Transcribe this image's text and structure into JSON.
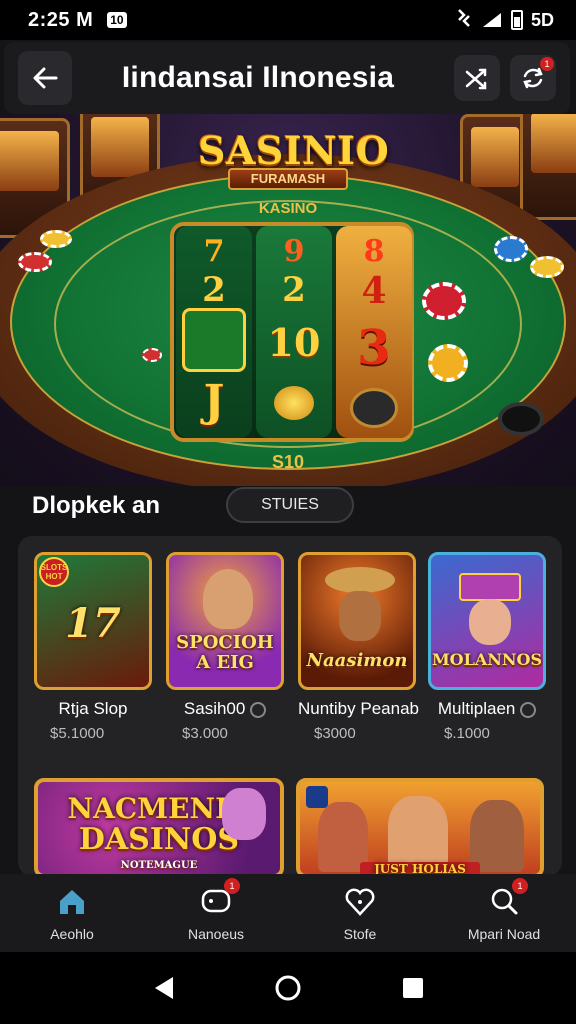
{
  "status_bar": {
    "time": "2:25 M",
    "badge": "10",
    "battery_text": "5D"
  },
  "header": {
    "title": "Iindansai Ilnonesia",
    "back_icon": "arrow-left-icon",
    "action1_icon": "shuffle-icon",
    "action2_icon": "refresh-icon",
    "notif_count": "1"
  },
  "hero": {
    "logo": "SASINIO",
    "logo_sub": "FURAMASH",
    "table_label": "KASINO",
    "bet_label": "S10",
    "reels": [
      [
        "7",
        "2",
        "J"
      ],
      [
        "9",
        "2",
        "10"
      ],
      [
        "8",
        "4",
        "3"
      ]
    ]
  },
  "section": {
    "title": "Dlopkek an",
    "pill": "STUIES"
  },
  "games": [
    {
      "name": "Rtja Slop",
      "price": "$5.1000",
      "art": "17",
      "corner": "SLOTS HOT",
      "colors": [
        "#1e7a3a",
        "#8a2a12"
      ]
    },
    {
      "name": "Sasih00",
      "price": "$3.000",
      "art": "SPOCIOH A EIG",
      "corner": "",
      "colors": [
        "#8a2ab0",
        "#f07a1a"
      ]
    },
    {
      "name": "Nuntiby Peanab",
      "price": "$3000",
      "art": "Naasimon",
      "corner": "",
      "colors": [
        "#d0501a",
        "#4a1a08"
      ]
    },
    {
      "name": "Multiplaen",
      "price": "$.1000",
      "art": "MOLANNOS",
      "corner": "",
      "colors": [
        "#3a6ad0",
        "#b02aa0"
      ]
    }
  ],
  "banners": [
    {
      "line1": "NACMENIC",
      "line2": "DASINOS",
      "line3": "NOTEMAGUE"
    },
    {
      "caption": "JUST HOLIAS"
    }
  ],
  "bottom_nav": [
    {
      "label": "Aeohlo",
      "icon": "home-icon"
    },
    {
      "label": "Nanoeus",
      "icon": "chat-icon",
      "dot": "1"
    },
    {
      "label": "Stofe",
      "icon": "heart-icon"
    },
    {
      "label": "Mpari Noad",
      "icon": "profile-search-icon",
      "dot": "1"
    }
  ],
  "colors": {
    "accent_gold": "#e0a030",
    "felt_green": "#117334",
    "nav_active": "#4aa0c8",
    "alert_red": "#d02020"
  }
}
